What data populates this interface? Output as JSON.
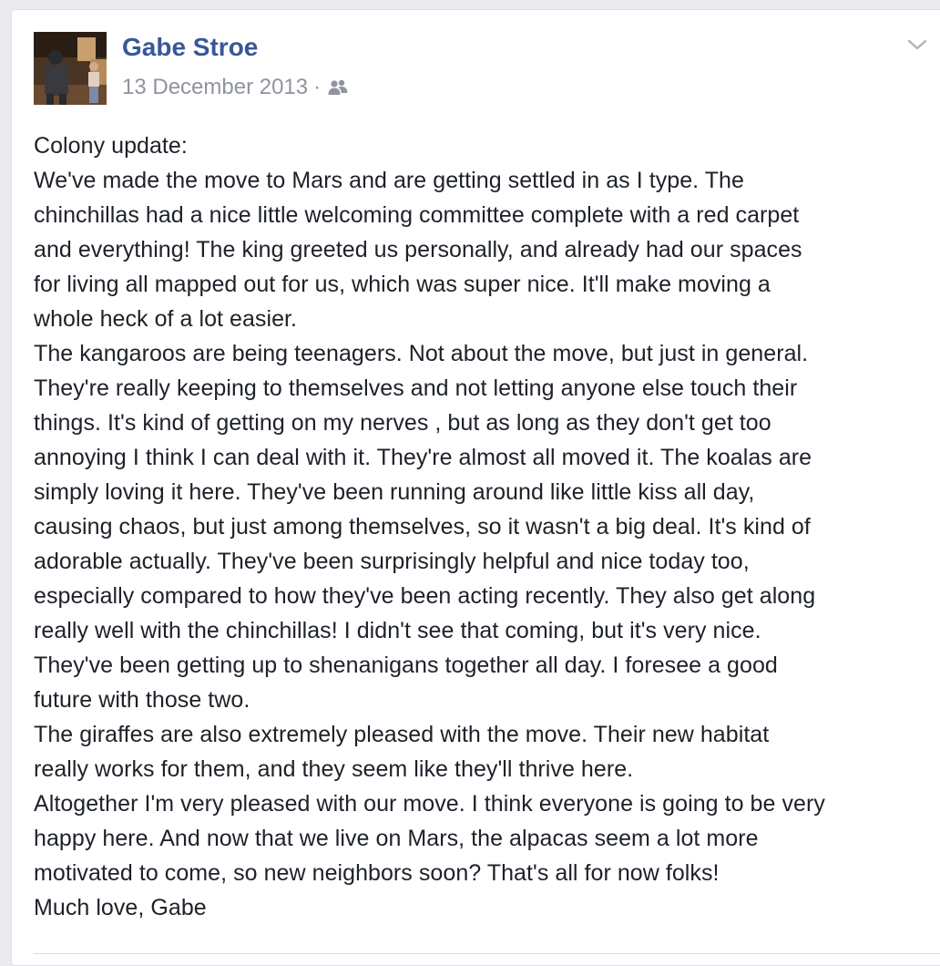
{
  "post": {
    "author": "Gabe Stroe",
    "date": "13 December 2013",
    "separator": "·",
    "audience_icon": "friends-icon",
    "menu_icon": "chevron-down-icon",
    "lines": [
      "Colony update:",
      "We've made the move to Mars and are getting settled in as I type. The",
      "chinchillas had a nice little welcoming committee complete with a red carpet",
      "and everything! The king greeted us personally, and already had our spaces",
      "for living all mapped out for us, which was super nice. It'll make moving a",
      "whole heck of a lot easier.",
      "The kangaroos are being teenagers. Not about the move, but just in general.",
      "They're really keeping to themselves and not letting anyone else touch their",
      "things. It's kind of getting on my nerves , but as long as they don't get too",
      "annoying I think I can deal with it. They're almost all moved it. The koalas are",
      "simply loving it here. They've been running around like little kiss all day,",
      "causing chaos, but just among themselves, so it wasn't a big deal. It's kind of",
      "adorable actually. They've been surprisingly helpful and nice today too,",
      "especially compared to how they've been acting recently. They also get along",
      "really well with the chinchillas! I didn't see that coming, but it's very nice.",
      "They've been getting up to shenanigans together all day. I foresee a good",
      "future with those two.",
      "The giraffes are also extremely pleased with the move. Their new habitat",
      "really works for them, and they seem like they'll thrive here.",
      "Altogether I'm very pleased with our move. I think everyone is going to be very",
      "happy here. And now that we live on Mars, the alpacas seem a lot more",
      "motivated to come, so new neighbors soon? That's all for now folks!",
      "Much love, Gabe"
    ]
  },
  "colors": {
    "author_link": "#365899",
    "meta_gray": "#90949c",
    "body_text": "#1d2129",
    "page_bg": "#e9ebee"
  }
}
